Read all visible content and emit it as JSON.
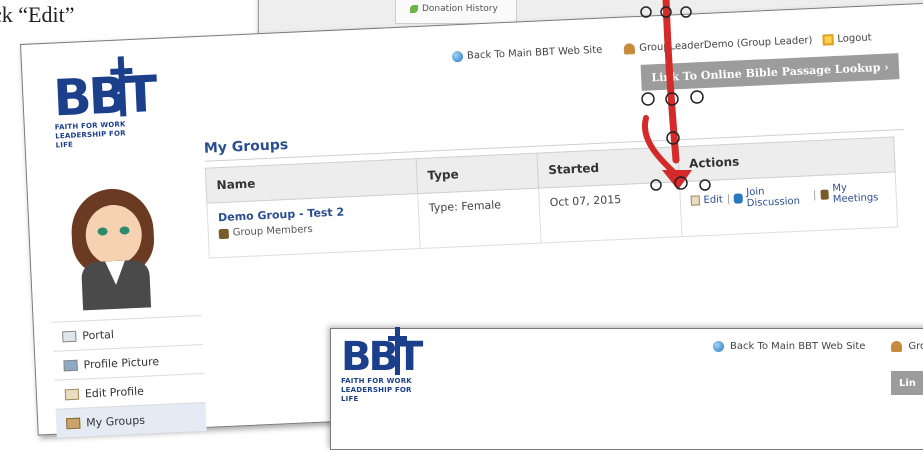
{
  "instruction": "ck “Edit”",
  "background_top": {
    "menu_item": "Donation History"
  },
  "header": {
    "back_link": "Back To Main BBT Web Site",
    "user": "GroupLeaderDemo (Group Leader)",
    "logout": "Logout",
    "lookup_button": "Link To Online Bible Passage Lookup  ›"
  },
  "logo": {
    "word": "BBT",
    "tagline_1": "FAITH FOR WORK",
    "tagline_2": "LEADERSHIP FOR LIFE"
  },
  "sidebar": {
    "items": [
      {
        "label": "Portal",
        "icon": "portal-icon"
      },
      {
        "label": "Profile Picture",
        "icon": "picture-icon"
      },
      {
        "label": "Edit Profile",
        "icon": "edit-icon"
      },
      {
        "label": "My Groups",
        "icon": "group-icon",
        "active": true
      }
    ]
  },
  "main": {
    "title": "My Groups",
    "columns": [
      "Name",
      "Type",
      "Started",
      "Actions"
    ],
    "rows": [
      {
        "name": "Demo Group - Test 2",
        "members_link": "Group Members",
        "type": "Type: Female",
        "started": "Oct 07, 2015",
        "actions": {
          "edit": "Edit",
          "join": "Join Discussion",
          "meetings": "My Meetings"
        }
      }
    ]
  },
  "lower_shot": {
    "back_link": "Back To Main BBT Web Site",
    "user": "Group",
    "button": "Lin"
  },
  "colors": {
    "brand": "#1c3f8c",
    "link": "#2a4f8f",
    "arrow": "#d42a2a"
  }
}
